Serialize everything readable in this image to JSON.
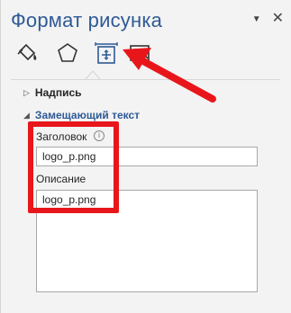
{
  "pane": {
    "title": "Формат рисунка",
    "tabs": [
      {
        "icon": "fill-bucket-icon"
      },
      {
        "icon": "pentagon-effects-icon"
      },
      {
        "icon": "size-layout-icon",
        "selected": true
      },
      {
        "icon": "picture-icon"
      }
    ],
    "sections": {
      "caption_label": "Надпись",
      "alt_text_label": "Замещающий текст"
    },
    "fields": {
      "title_label": "Заголовок",
      "title_value": "logo_p.png",
      "description_label": "Описание",
      "description_value": "logo_p.png"
    }
  },
  "colors": {
    "title": "#2e5a96",
    "highlight": "#e8161b",
    "background": "#f3f3f3"
  }
}
